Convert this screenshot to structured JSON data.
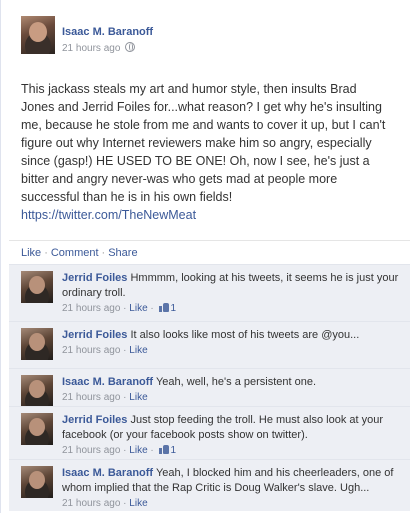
{
  "post": {
    "author": "Isaac M. Baranoff",
    "time": "21 hours ago",
    "text": "This jackass steals my art and humor style, then insults Brad Jones and Jerrid Foiles for...what reason? I get why he's insulting me, because he stole from me and wants to cover it up, but I can't figure out why Internet reviewers make him so angry, especially since (gasp!) HE USED TO BE ONE! Oh, now I see, he's just a bitter and angry never-was who gets mad at people more successful than he is in his own fields!",
    "link": "https://twitter.com/TheNewMeat"
  },
  "actions": {
    "like": "Like",
    "comment": "Comment",
    "share": "Share"
  },
  "comments": [
    {
      "author": "Jerrid Foiles",
      "text": "Hmmmm, looking at his tweets, it seems he is just your ordinary troll.",
      "time": "21 hours ago",
      "like": "Like",
      "likes": "1"
    },
    {
      "author": "Jerrid Foiles",
      "text": "It also looks like most of his tweets are @you...",
      "time": "21 hours ago",
      "like": "Like",
      "likes": ""
    },
    {
      "author": "Isaac M. Baranoff",
      "text": "Yeah, well, he's a persistent one.",
      "time": "21 hours ago",
      "like": "Like",
      "likes": ""
    },
    {
      "author": "Jerrid Foiles",
      "text": "Just stop feeding the troll. He must also look at your facebook (or your facebook posts show on twitter).",
      "time": "21 hours ago",
      "like": "Like",
      "likes": "1"
    },
    {
      "author": "Isaac M. Baranoff",
      "text": "Yeah, I blocked him and his cheerleaders, one of whom implied that the Rap Critic is Doug Walker's slave. Ugh...",
      "time": "21 hours ago",
      "like": "Like",
      "likes": ""
    }
  ]
}
